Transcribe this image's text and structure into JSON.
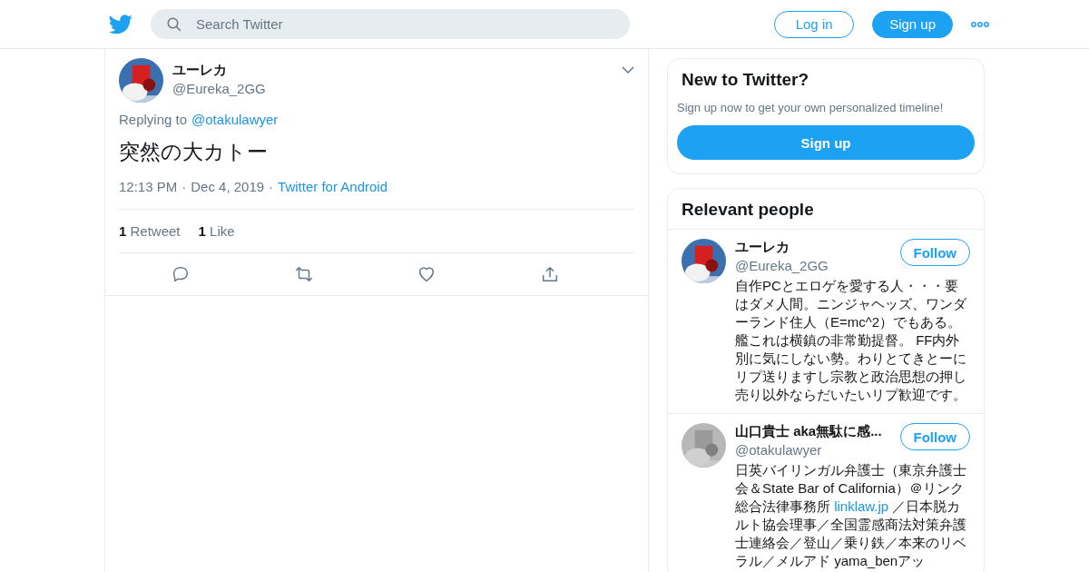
{
  "header": {
    "search": {
      "placeholder": "Search Twitter"
    },
    "buttons": [
      {
        "label": "Log in",
        "kind": "outline"
      },
      {
        "label": "Sign up",
        "kind": "filled"
      }
    ]
  },
  "tweet": {
    "name": "ユーレカ",
    "handle": "@Eureka_2GG",
    "replying_label": "Replying to",
    "replying_to": "@otakulawyer",
    "text": "突然の大カトー",
    "time": "12:13 PM",
    "separator": "·",
    "date": "Dec 4, 2019",
    "source": "Twitter for Android",
    "stats": [
      {
        "count": "1",
        "label": "Retweet"
      },
      {
        "count": "1",
        "label": "Like"
      }
    ],
    "actions": [
      {
        "kind": "reply"
      },
      {
        "kind": "retweet"
      },
      {
        "kind": "like"
      },
      {
        "kind": "share"
      }
    ]
  },
  "signup_card": {
    "title": "New to Twitter?",
    "subtitle": "Sign up now to get your own personalized timeline!",
    "button": "Sign up"
  },
  "relevant_people": {
    "title": "Relevant people",
    "people": [
      {
        "name": "ユーレカ",
        "handle": "@Eureka_2GG",
        "follow": "Follow",
        "avatar": {
          "kind": "picture"
        },
        "bio": [
          {
            "kind": "text",
            "text": "自作PCとエロゲを愛する人・・・要はダメ人間。ニンジャヘッズ、ワンダーランド住人（E=mc^2）でもある。艦これは横鎮の非常勤提督。 FF内外別に気にしない勢。わりとてきとーにリプ送りますし宗教と政治思想の押し売り以外ならだいたいリプ歓迎です。"
          }
        ]
      },
      {
        "name": "山口貴士 aka無駄に感...",
        "handle": "@otakulawyer",
        "follow": "Follow",
        "avatar": {
          "kind": "picture"
        },
        "bio": [
          {
            "kind": "text",
            "text": "日英バイリンガル弁護士（東京弁護士会＆State Bar of California）＠リンク総合法律事務所 "
          },
          {
            "kind": "link",
            "text": "linklaw.jp"
          },
          {
            "kind": "text",
            "text": " ／日本脱カルト協会理事／全国霊感商法対策弁護士連絡会／登山／乗り鉄／本来のリベラル／メルアド yama_benアッ"
          }
        ]
      }
    ]
  }
}
